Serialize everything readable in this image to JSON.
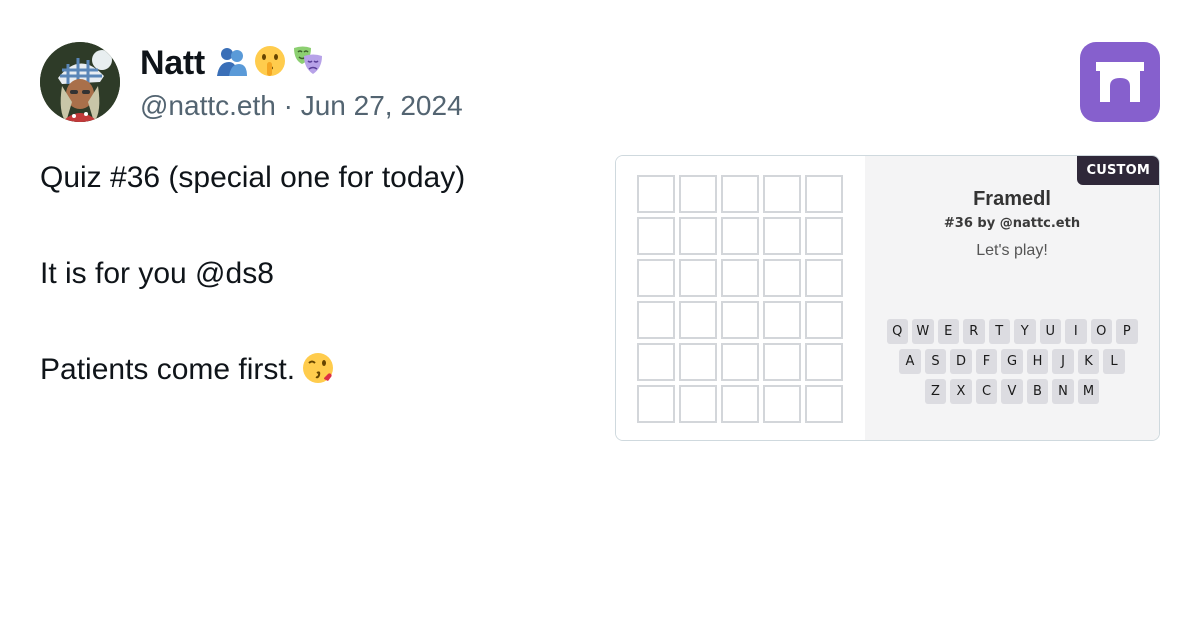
{
  "author": {
    "display_name": "Natt",
    "name_emojis": [
      "people-hugging-emoji",
      "shushing-face-emoji",
      "performing-arts-emoji"
    ],
    "handle": "@nattc.eth",
    "separator": "·",
    "date": "Jun 27, 2024"
  },
  "post": {
    "lines": [
      "Quiz #36 (special one for today)",
      "It is for you @ds8",
      "Patients come first."
    ],
    "trailing_emoji": "face-blowing-a-kiss-emoji"
  },
  "app_logo": {
    "icon": "arch-icon",
    "color": "#8660cd"
  },
  "frame": {
    "badge": "CUSTOM",
    "title": "Framedl",
    "subtitle": "#36 by @nattc.eth",
    "status": "Let's play!",
    "grid": {
      "rows": 6,
      "cols": 5
    },
    "keyboard": {
      "row1": [
        "Q",
        "W",
        "E",
        "R",
        "T",
        "Y",
        "U",
        "I",
        "O",
        "P"
      ],
      "row2": [
        "A",
        "S",
        "D",
        "F",
        "G",
        "H",
        "J",
        "K",
        "L"
      ],
      "row3": [
        "Z",
        "X",
        "C",
        "V",
        "B",
        "N",
        "M"
      ]
    }
  }
}
